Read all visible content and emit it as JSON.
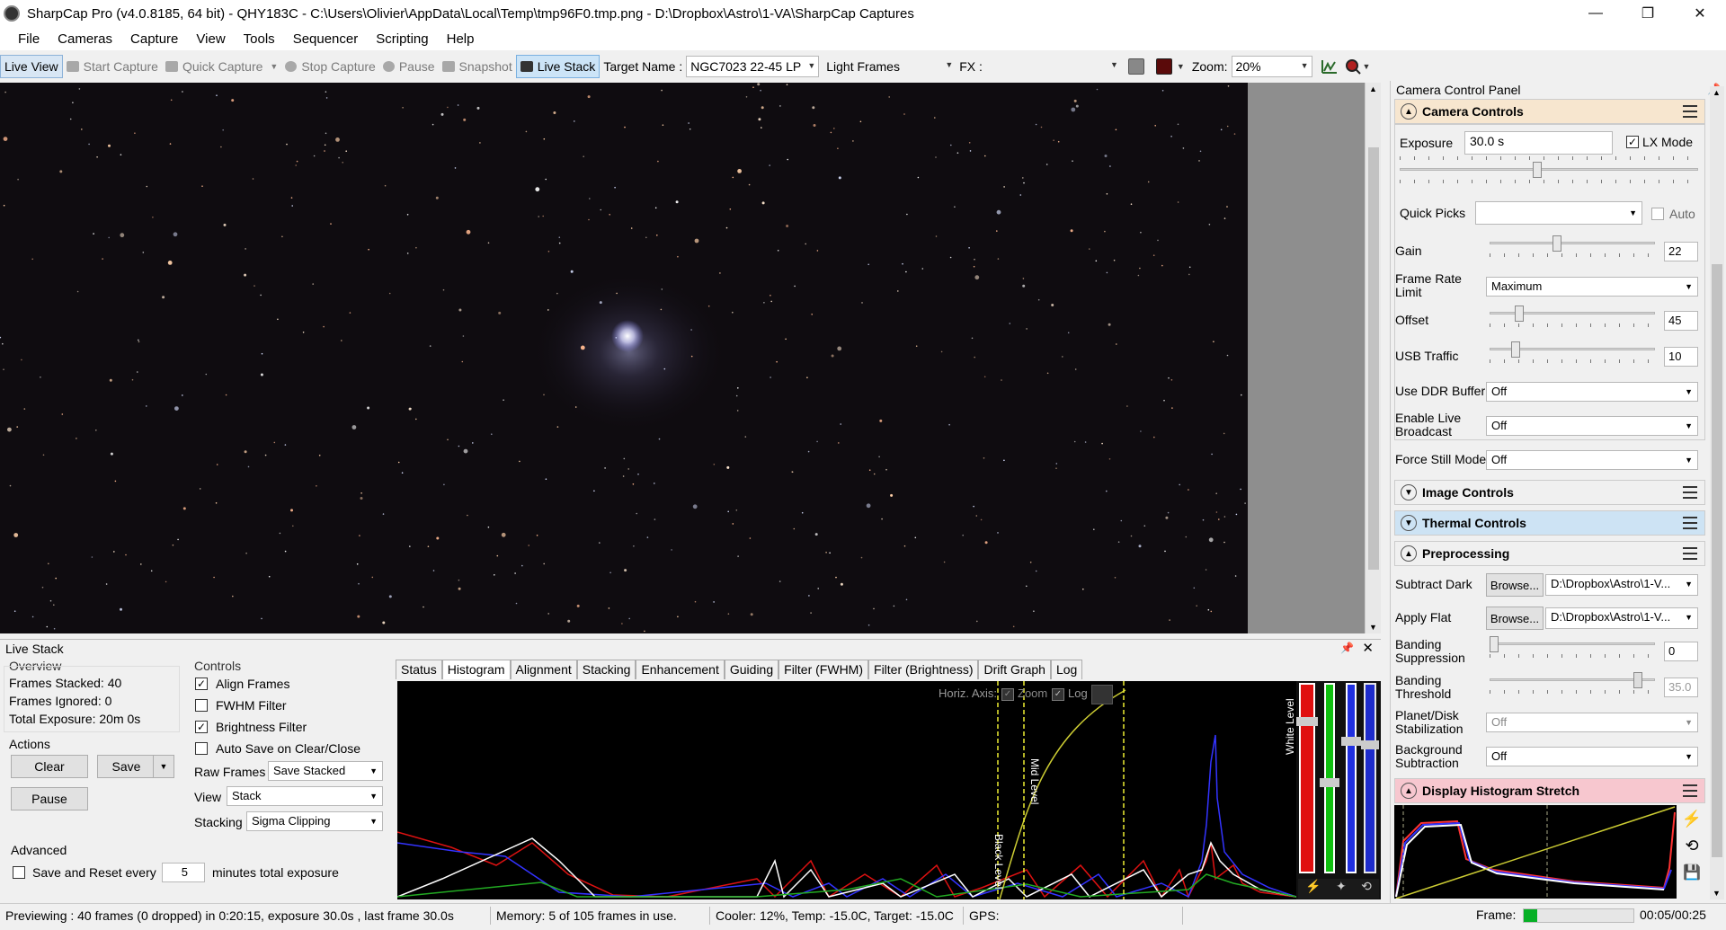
{
  "window": {
    "title": "SharpCap Pro (v4.0.8185, 64 bit) - QHY183C - C:\\Users\\Olivier\\AppData\\Local\\Temp\\tmp96F0.tmp.png - D:\\Dropbox\\Astro\\1-VA\\SharpCap Captures",
    "minimize": "—",
    "maximize": "❐",
    "close": "✕"
  },
  "menu": [
    "File",
    "Cameras",
    "Capture",
    "View",
    "Tools",
    "Sequencer",
    "Scripting",
    "Help"
  ],
  "toolbar": {
    "live_view": "Live View",
    "start_capture": "Start Capture",
    "quick_capture": "Quick Capture",
    "stop_capture": "Stop Capture",
    "pause": "Pause",
    "snapshot": "Snapshot",
    "live_stack": "Live Stack",
    "target_name_label": "Target Name :",
    "target_name_value": "NGC7023 22-45 LP",
    "frame_type": "Light Frames",
    "fx_label": "FX :",
    "fx_value": "",
    "zoom_label": "Zoom:",
    "zoom_value": "20%"
  },
  "camera_panel": {
    "title": "Camera Control Panel",
    "camera_controls": {
      "header": "Camera Controls",
      "exposure_label": "Exposure",
      "exposure_value": "30.0 s",
      "lx_mode_label": "LX Mode",
      "lx_mode_checked": true,
      "quick_picks_label": "Quick Picks",
      "quick_picks_value": "",
      "auto_label": "Auto",
      "gain_label": "Gain",
      "gain_value": "22",
      "frame_rate_label": "Frame Rate Limit",
      "frame_rate_value": "Maximum",
      "offset_label": "Offset",
      "offset_value": "45",
      "usb_label": "USB Traffic",
      "usb_value": "10",
      "ddr_label": "Use DDR Buffer",
      "ddr_value": "Off",
      "broadcast_label": "Enable Live Broadcast",
      "broadcast_value": "Off",
      "still_label": "Force Still Mode",
      "still_value": "Off"
    },
    "image_controls_header": "Image Controls",
    "thermal_controls_header": "Thermal Controls",
    "preprocessing": {
      "header": "Preprocessing",
      "dark_label": "Subtract Dark",
      "dark_browse": "Browse...",
      "dark_path": "D:\\Dropbox\\Astro\\1-V...",
      "flat_label": "Apply Flat",
      "flat_browse": "Browse...",
      "flat_path": "D:\\Dropbox\\Astro\\1-V...",
      "banding_sup_label": "Banding Suppression",
      "banding_sup_value": "0",
      "banding_thr_label": "Banding Threshold",
      "banding_thr_value": "35.0",
      "planet_label": "Planet/Disk Stabilization",
      "planet_value": "Off",
      "bg_label": "Background Subtraction",
      "bg_value": "Off"
    },
    "histogram_stretch_header": "Display Histogram Stretch"
  },
  "live_stack": {
    "title": "Live Stack",
    "overview_label": "Overview",
    "frames_stacked": "Frames Stacked: 40",
    "frames_ignored": "Frames Ignored:  0",
    "total_exposure": "Total Exposure:    20m 0s",
    "actions_label": "Actions",
    "clear": "Clear",
    "save": "Save",
    "pause": "Pause",
    "advanced_label": "Advanced",
    "save_reset": "Save and Reset every",
    "reset_minutes": "5",
    "minutes_total": "minutes total exposure",
    "controls_label": "Controls",
    "align_frames": "Align Frames",
    "fwhm_filter": "FWHM Filter",
    "brightness_filter": "Brightness Filter",
    "auto_save": "Auto Save on Clear/Close",
    "raw_frames_label": "Raw Frames",
    "raw_frames_value": "Save Stacked",
    "view_label": "View",
    "view_value": "Stack",
    "stacking_label": "Stacking",
    "stacking_value": "Sigma Clipping",
    "tabs": [
      "Status",
      "Histogram",
      "Alignment",
      "Stacking",
      "Enhancement",
      "Guiding",
      "Filter (FWHM)",
      "Filter (Brightness)",
      "Drift Graph",
      "Log"
    ],
    "selected_tab": "Histogram",
    "horiz_axis_label": "Horiz. Axis:",
    "zoom_option": "Zoom",
    "log_option": "Log",
    "black_level": "Black Level",
    "mid_level": "Mid Level",
    "white_level": "White Level"
  },
  "status_bar": {
    "preview": "Previewing : 40 frames (0 dropped) in 0:20:15, exposure 30.0s , last frame 30.0s",
    "memory": "Memory: 5 of 105 frames in use.",
    "cooler": "Cooler: 12%, Temp: -15.0C, Target: -15.0C",
    "gps": "GPS:",
    "frame_label": "Frame:",
    "frame_progress": 0.12,
    "elapsed": "00:05/00:25"
  },
  "colors": {
    "camera_header": "#f7e6cf",
    "thermal_header": "#cde3f4",
    "stretch_header": "#f7c7cf",
    "active_button": "#cce4f7"
  }
}
